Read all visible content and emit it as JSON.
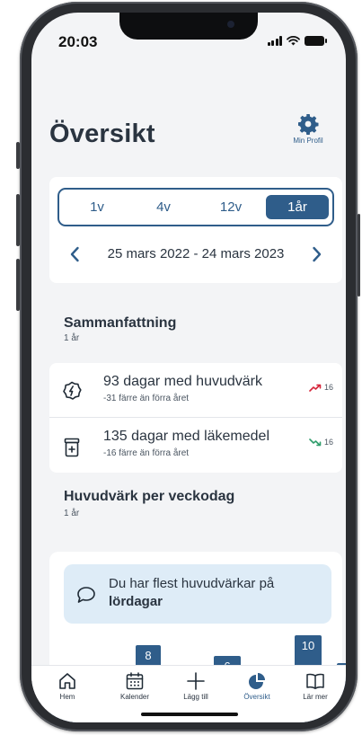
{
  "status_bar": {
    "time": "20:03"
  },
  "header": {
    "title": "Översikt",
    "profile_label": "Min Profil"
  },
  "period": {
    "options": [
      "1v",
      "4v",
      "12v",
      "1år"
    ],
    "selected": "1år",
    "range": "25 mars 2022 - 24 mars 2023"
  },
  "summary": {
    "title": "Sammanfattning",
    "subtitle": "1 år",
    "rows": [
      {
        "icon": "headache-icon",
        "main": "93 dagar med huvudvärk",
        "sub": "-31 färre än förra året",
        "trend_value": "16",
        "trend_icon": "trend-up-icon",
        "trend_color": "#d6263b"
      },
      {
        "icon": "medicine-icon",
        "main": "135 dagar med läkemedel",
        "sub": "-16 färre än förra året",
        "trend_value": "16",
        "trend_icon": "trend-down-icon",
        "trend_color": "#2f9d6b"
      }
    ]
  },
  "weekday": {
    "title": "Huvudvärk per veckodag",
    "subtitle": "1 år",
    "insight_text": "Du har flest huvudvärkar på",
    "insight_highlight": "lördagar",
    "bar_labels": [
      "8",
      "6",
      "10"
    ]
  },
  "tabbar": {
    "items": [
      {
        "label": "Hem",
        "icon": "home-icon"
      },
      {
        "label": "Kalender",
        "icon": "calendar-icon"
      },
      {
        "label": "Lägg till",
        "icon": "plus-icon"
      },
      {
        "label": "Översikt",
        "icon": "pie-chart-icon"
      },
      {
        "label": "Lär mer",
        "icon": "book-icon"
      }
    ],
    "active": "Översikt"
  },
  "colors": {
    "accent": "#2f5d8a",
    "background": "#f3f4f6",
    "insight_bg": "#deecf7"
  }
}
